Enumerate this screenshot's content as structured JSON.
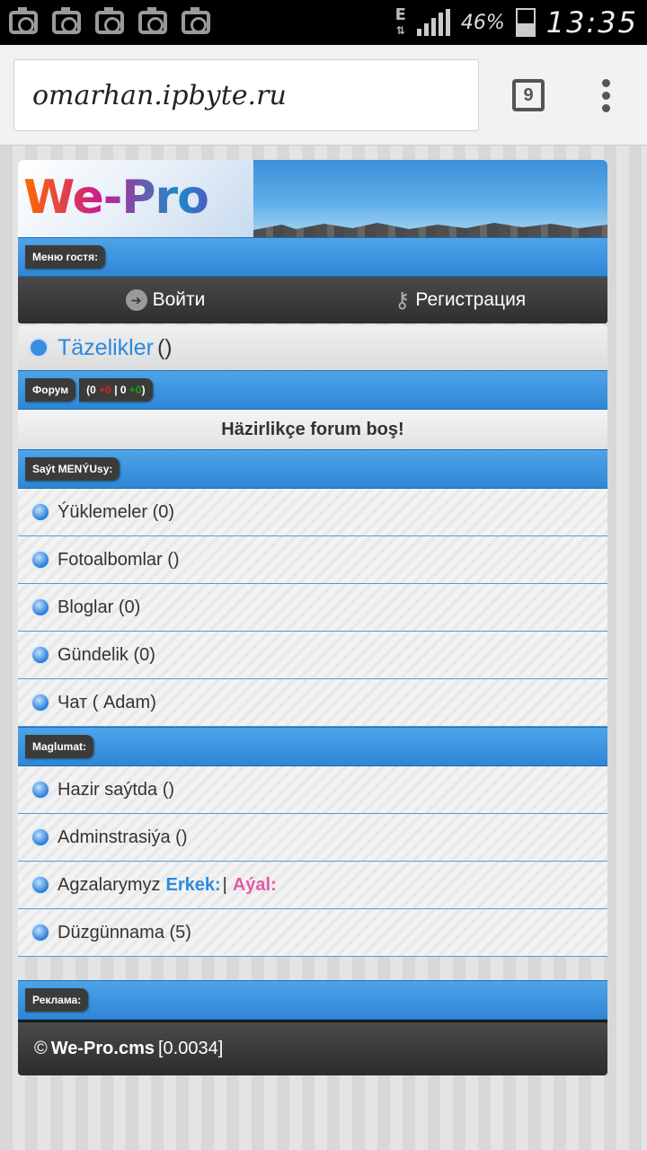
{
  "status_bar": {
    "network": "E",
    "battery": "46%",
    "time": "13:35"
  },
  "browser": {
    "url": "omarhan.ipbyte.ru",
    "tab_count": "9"
  },
  "header": {
    "logo": "We-Pro cms"
  },
  "guest_menu": {
    "title": "Меню гостя:",
    "login": "Войти",
    "register": "Регистрация"
  },
  "news": {
    "title": "Täzelikler",
    "count": "()"
  },
  "forum": {
    "title": "Форум",
    "stats_open": "(0",
    "stats_new": "+0",
    "stats_sep1": "|",
    "stats_mid": "0",
    "stats_new2": "+0",
    "stats_close": ")",
    "empty_message": "Häzirlikçe forum boş!"
  },
  "site_menu": {
    "title": "Saýt MENÝUsy:",
    "items": [
      {
        "label": "Ýüklemeler (0)",
        "icon": "speaker-icon"
      },
      {
        "label": "Fotoalbomlar ()",
        "icon": "camera-icon"
      },
      {
        "label": "Bloglar (0)",
        "icon": "pencil-icon"
      },
      {
        "label": "Gündelik (0)",
        "icon": "pencil-icon"
      },
      {
        "label": "Чат ( Adam)",
        "icon": "chat-icon"
      }
    ]
  },
  "info": {
    "title": "Maglumat:",
    "online": "Hazir saýtda ()",
    "admins": "Adminstrasiýa ()",
    "members_label": "Agzalarymyz",
    "male": "Erkek:",
    "separator": "|",
    "female": "Aýal:",
    "rules": "Düzgünnama (5)"
  },
  "ads": {
    "title": "Реклама:"
  },
  "footer": {
    "copyright": "©",
    "brand": "We-Pro.cms",
    "time": "[0.0034]"
  },
  "colors": {
    "accent_blue": "#2f86d6",
    "link_blue": "#2a8ae0",
    "female_pink": "#e45aa7",
    "dark_bar": "#2e2e2e"
  }
}
